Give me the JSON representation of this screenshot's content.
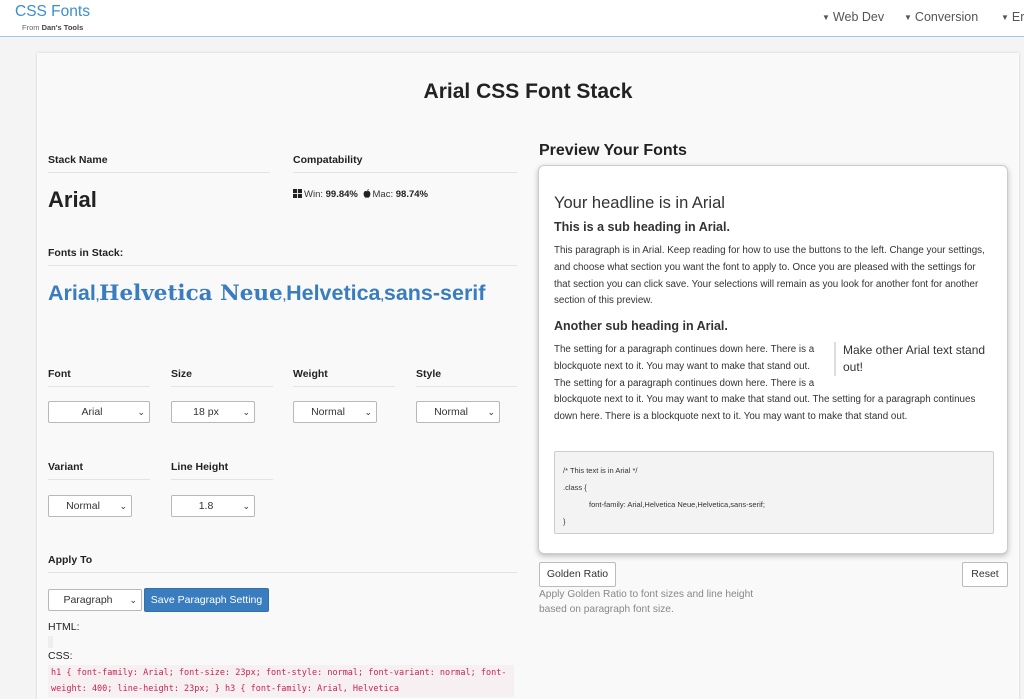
{
  "nav": {
    "brand_title": "CSS Fonts",
    "brand_sub_prefix": "From",
    "brand_sub_name": "Dan's Tools",
    "items": [
      "Web Dev",
      "Conversion",
      "Er"
    ]
  },
  "page": {
    "title": "Arial CSS Font Stack"
  },
  "stack": {
    "name_label": "Stack Name",
    "name": "Arial",
    "compat_label": "Compatability",
    "win_label": "Win:",
    "win_pct": "99.84%",
    "mac_label": "Mac:",
    "mac_pct": "98.74%",
    "fonts_label": "Fonts in Stack:",
    "fonts": [
      "Arial",
      "Helvetica Neue",
      "Helvetica",
      "sans-serif"
    ],
    "separator": ","
  },
  "controls": {
    "font_label": "Font",
    "font_value": "Arial",
    "size_label": "Size",
    "size_value": "18 px",
    "weight_label": "Weight",
    "weight_value": "Normal",
    "style_label": "Style",
    "style_value": "Normal",
    "variant_label": "Variant",
    "variant_value": "Normal",
    "line_height_label": "Line Height",
    "line_height_value": "1.8",
    "apply_label": "Apply To",
    "apply_value": "Paragraph",
    "save_button": "Save Paragraph Setting"
  },
  "output": {
    "html_label": "HTML:",
    "css_label": "CSS:",
    "css_code": "h1 { font-family: Arial; font-size: 23px; font-style: normal; font-variant: normal; font-weight: 400; line-height: 23px; } h3 { font-family: Arial, Helvetica"
  },
  "preview": {
    "title": "Preview Your Fonts",
    "h1": "Your headline is in Arial",
    "h3_1": "This is a sub heading in Arial.",
    "para1": "This paragraph is in Arial. Keep reading for how to use the buttons to the left. Change your settings, and choose what section you want the font to apply to. Once you are pleased with the settings for that section you can click save. Your selections will remain as you look for another font for another section of this preview.",
    "h3_2": "Another sub heading in Arial.",
    "quote": "Make other Arial text stand out!",
    "para2": "The setting for a paragraph continues down here. There is a blockquote next to it. You may want to make that stand out. The setting for a paragraph continues down here. There is a blockquote next to it. You may want to make that stand out. The setting for a paragraph continues down here. There is a blockquote next to it. You may want to make that stand out.",
    "code_comment": "/* This text is in Arial */",
    "code_selector": ".class {",
    "code_rule": "font-family: Arial,Helvetica Neue,Helvetica,sans-serif;",
    "code_close": "}",
    "golden_button": "Golden Ratio",
    "reset_button": "Reset",
    "golden_note": "Apply Golden Ratio to font sizes and line height based on paragraph font size."
  }
}
